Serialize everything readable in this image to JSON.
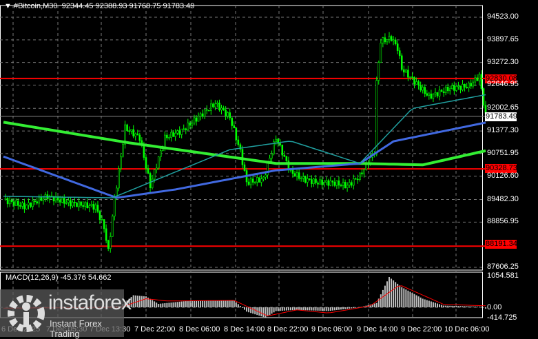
{
  "header": {
    "symbol": "#Bitcoin,M30",
    "ohlc": "92344.45 92388.93 91768.75 91783.49"
  },
  "price_axis": [
    "94523.00",
    "93897.65",
    "93272.30",
    "92646.95",
    "92002.65",
    "91377.30",
    "90751.95",
    "90126.60",
    "89482.30",
    "88856.95",
    "87606.25"
  ],
  "levels": [
    {
      "label": "92830.08",
      "value": 92830.08
    },
    {
      "label": "90328.73",
      "value": 90328.73
    },
    {
      "label": "88191.34",
      "value": 88191.34
    }
  ],
  "current_price": {
    "label": "91783.49",
    "value": 91783.49
  },
  "macd": {
    "label": "MACD(12,26,9) -45.376 54.662",
    "axis_top": "1054.581",
    "axis_zero": "0.00",
    "axis_bottom": "-414.725"
  },
  "time_axis": [
    "6 Dec 2025",
    "7 Dec 05:30",
    "7 Dec 13:30",
    "7 Dec 22:00",
    "8 Dec 06:00",
    "8 Dec 14:00",
    "8 Dec 22:00",
    "9 Dec 06:00",
    "9 Dec 14:00",
    "9 Dec 22:00",
    "10 Dec 06:00"
  ],
  "watermark": {
    "name": "instaforex",
    "tagline": "Instant Forex Trading"
  },
  "colors": {
    "candle": "#00ff00",
    "ma_slow": "#33ee33",
    "ma_mid": "#4169e1",
    "ma_fast": "#20a0a0",
    "level": "#ff0000",
    "signal": "#ff0000",
    "hist": "#c0c0c0"
  },
  "chart_data": {
    "type": "candlestick",
    "bars": 230,
    "ylim": [
      87606.25,
      94523.0
    ],
    "close_keypoints": [
      [
        0,
        89480
      ],
      [
        10,
        89290
      ],
      [
        21,
        89570
      ],
      [
        31,
        89390
      ],
      [
        44,
        89280
      ],
      [
        48,
        88710
      ],
      [
        50,
        88050
      ],
      [
        53,
        89480
      ],
      [
        58,
        91470
      ],
      [
        65,
        91190
      ],
      [
        70,
        89860
      ],
      [
        77,
        91190
      ],
      [
        85,
        91380
      ],
      [
        95,
        91860
      ],
      [
        101,
        92140
      ],
      [
        108,
        91760
      ],
      [
        113,
        90810
      ],
      [
        116,
        89950
      ],
      [
        124,
        90050
      ],
      [
        130,
        91190
      ],
      [
        137,
        90240
      ],
      [
        143,
        90050
      ],
      [
        150,
        89950
      ],
      [
        157,
        89950
      ],
      [
        164,
        89860
      ],
      [
        170,
        90140
      ],
      [
        177,
        90810
      ],
      [
        178,
        92710
      ],
      [
        180,
        93860
      ],
      [
        185,
        93950
      ],
      [
        188,
        93670
      ],
      [
        190,
        93100
      ],
      [
        195,
        92810
      ],
      [
        203,
        92330
      ],
      [
        213,
        92560
      ],
      [
        222,
        92620
      ],
      [
        227,
        92900
      ],
      [
        230,
        91790
      ]
    ],
    "ma_slow": [
      [
        0,
        91620
      ],
      [
        60,
        91050
      ],
      [
        130,
        90480
      ],
      [
        170,
        90480
      ],
      [
        200,
        90440
      ],
      [
        230,
        90830
      ]
    ],
    "ma_mid": [
      [
        0,
        90670
      ],
      [
        54,
        89530
      ],
      [
        82,
        89760
      ],
      [
        130,
        90290
      ],
      [
        170,
        90480
      ],
      [
        186,
        91090
      ],
      [
        230,
        91610
      ]
    ],
    "ma_fast": [
      [
        0,
        89570
      ],
      [
        52,
        89530
      ],
      [
        108,
        90860
      ],
      [
        137,
        91100
      ],
      [
        170,
        90480
      ],
      [
        195,
        92000
      ],
      [
        230,
        92380
      ]
    ],
    "macd_hist": [
      [
        0,
        0
      ],
      [
        40,
        10
      ],
      [
        56,
        50
      ],
      [
        62,
        420
      ],
      [
        68,
        380
      ],
      [
        74,
        120
      ],
      [
        90,
        240
      ],
      [
        110,
        240
      ],
      [
        116,
        -150
      ],
      [
        125,
        -360
      ],
      [
        130,
        -130
      ],
      [
        140,
        -90
      ],
      [
        155,
        -130
      ],
      [
        170,
        0
      ],
      [
        178,
        150
      ],
      [
        184,
        1054
      ],
      [
        190,
        700
      ],
      [
        200,
        300
      ],
      [
        210,
        60
      ],
      [
        228,
        20
      ],
      [
        230,
        -45
      ]
    ],
    "macd_signal": [
      [
        0,
        -30
      ],
      [
        56,
        0
      ],
      [
        68,
        300
      ],
      [
        78,
        220
      ],
      [
        110,
        240
      ],
      [
        126,
        -300
      ],
      [
        140,
        -90
      ],
      [
        155,
        -200
      ],
      [
        175,
        50
      ],
      [
        189,
        780
      ],
      [
        210,
        100
      ],
      [
        229,
        55
      ]
    ]
  }
}
